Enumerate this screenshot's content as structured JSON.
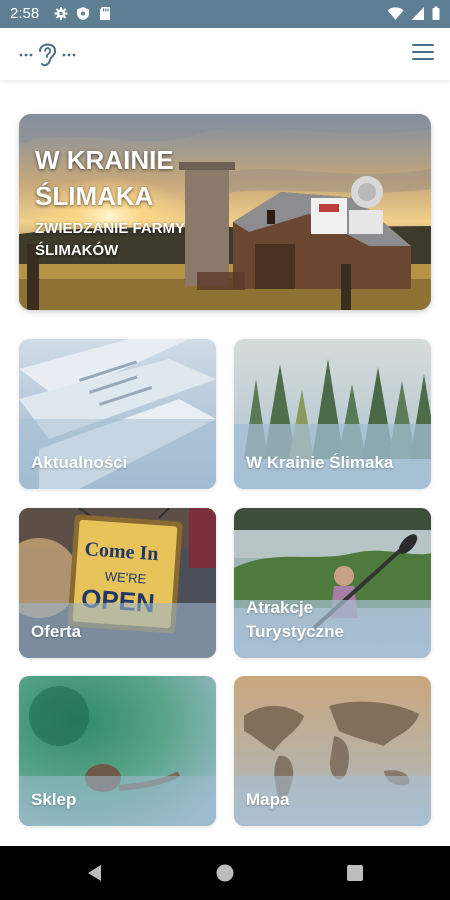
{
  "status_bar": {
    "time": "2:58",
    "left_icons": [
      "gear-icon",
      "shield-icon",
      "sd-card-icon"
    ],
    "right_icons": [
      "wifi-icon",
      "signal-icon",
      "battery-icon"
    ],
    "background": "#5e7f93"
  },
  "app_bar": {
    "logo": "ear-logo",
    "menu_icon": "hamburger-menu-icon",
    "accent": "#4a6f85"
  },
  "hero": {
    "title": "W KRAINIE ŚLIMAKA",
    "subtitle": "ZWIEDZANIE FARMY ŚLIMAKÓW"
  },
  "tiles": [
    {
      "label": "Aktualności",
      "image": "newspapers"
    },
    {
      "label": "W Krainie Ślimaka",
      "image": "forest"
    },
    {
      "label": "Oferta",
      "image": "come-in-open-sign"
    },
    {
      "label": "Atrakcje Turystyczne",
      "image": "kayaking-on-lake"
    },
    {
      "label": "Sklep",
      "image": "snail-on-green"
    },
    {
      "label": "Mapa",
      "image": "world-map"
    }
  ],
  "nav_bar": {
    "buttons": [
      "back-icon",
      "home-icon",
      "recents-icon"
    ]
  }
}
